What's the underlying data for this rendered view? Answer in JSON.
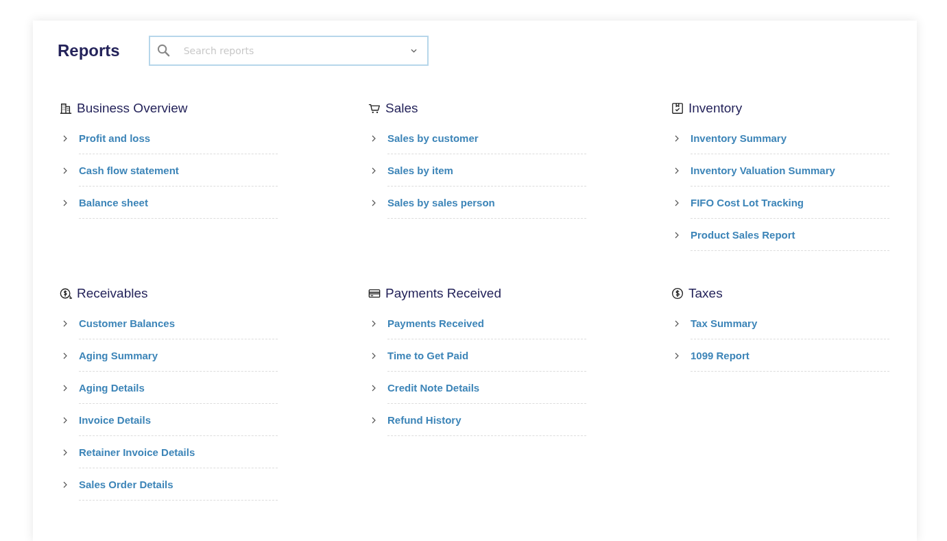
{
  "page": {
    "title": "Reports"
  },
  "search": {
    "placeholder": "Search reports"
  },
  "sections": [
    {
      "title": "Business Overview",
      "items": [
        "Profit and loss",
        "Cash flow statement",
        "Balance sheet"
      ]
    },
    {
      "title": "Sales",
      "items": [
        "Sales by customer",
        "Sales by item",
        "Sales by sales person"
      ]
    },
    {
      "title": "Inventory",
      "items": [
        "Inventory Summary",
        "Inventory Valuation Summary",
        "FIFO Cost Lot Tracking",
        "Product Sales Report"
      ]
    },
    {
      "title": "Receivables",
      "items": [
        "Customer Balances",
        "Aging Summary",
        "Aging Details",
        "Invoice Details",
        "Retainer Invoice Details",
        "Sales Order Details"
      ]
    },
    {
      "title": "Payments Received",
      "items": [
        "Payments Received",
        "Time to Get Paid",
        "Credit Note Details",
        "Refund History"
      ]
    },
    {
      "title": "Taxes",
      "items": [
        "Tax Summary",
        "1099 Report"
      ]
    }
  ]
}
